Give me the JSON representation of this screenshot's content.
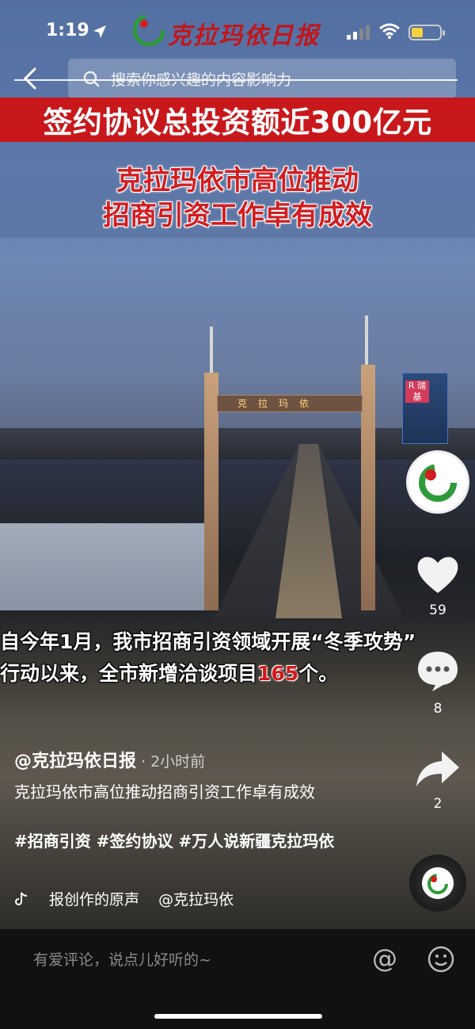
{
  "status_bar": {
    "time": "1:19"
  },
  "brand": {
    "name": "克拉玛依日报"
  },
  "search": {
    "placeholder": "搜索你感兴趣的内容",
    "overlay_text": "影响力"
  },
  "video": {
    "headline": "签约协议总投资额近300亿元",
    "subtitle_line1": "克拉玛依市高位推动",
    "subtitle_line2": "招商引资工作卓有成效",
    "bridge_sign": "克拉玛依",
    "building_sign": "R 瑞\n基",
    "caption_line1": "自今年1月，我市招商引资领域开展“冬季攻势”",
    "caption_line2_prefix": "行动以来，全市新增洽谈项目",
    "caption_line2_number": "165",
    "caption_line2_suffix": "个。"
  },
  "actions": {
    "likes": "59",
    "comments": "8",
    "shares": "2"
  },
  "post": {
    "author": "@克拉玛依日报",
    "time": "· 2小时前",
    "description": "克拉玛依市高位推动招商引资工作卓有成效",
    "tags": "#招商引资 #签约协议 #万人说新疆克拉玛依",
    "music_title": "报创作的原声",
    "music_author": "@克拉玛依"
  },
  "comment_bar": {
    "placeholder": "有爱评论，说点儿好听的~"
  },
  "icons": [
    "location-arrow-icon",
    "signal-icon",
    "wifi-icon",
    "battery-icon",
    "back-icon",
    "search-icon",
    "heart-icon",
    "comment-icon",
    "share-icon",
    "music-note-icon",
    "at-icon",
    "emoji-icon"
  ],
  "colors": {
    "brand_red": "#c8181b",
    "battery": "#f4d03f"
  }
}
